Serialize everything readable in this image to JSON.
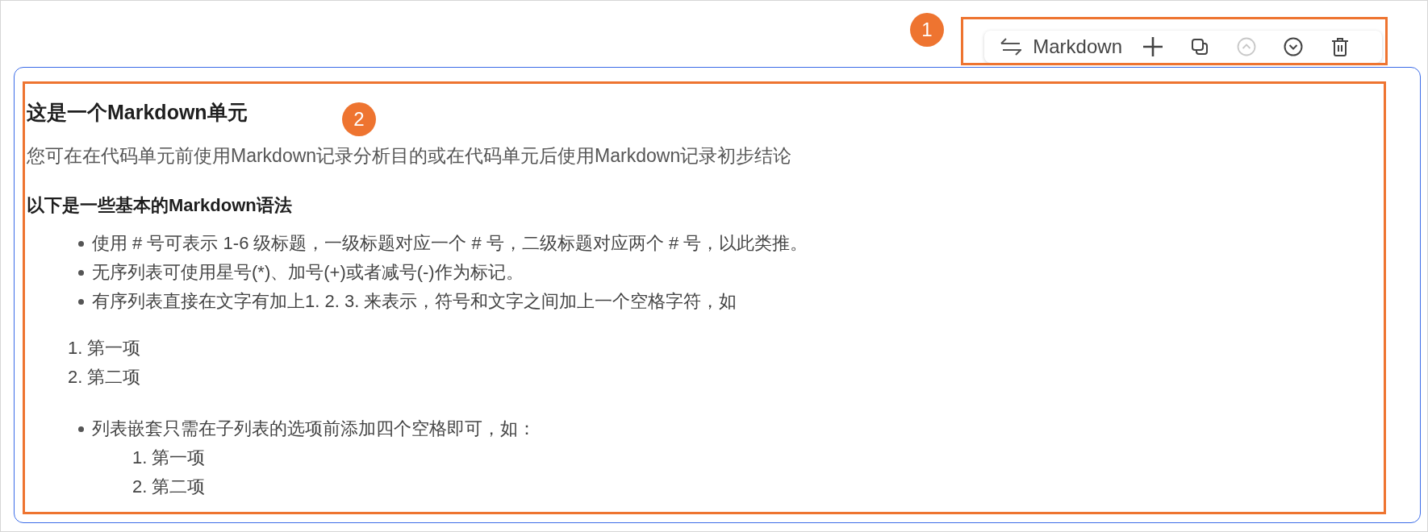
{
  "toolbar": {
    "cell_type": "Markdown",
    "buttons": [
      {
        "kind": "add",
        "disabled": false
      },
      {
        "kind": "copy",
        "disabled": false
      },
      {
        "kind": "move_up",
        "disabled": true
      },
      {
        "kind": "move_down",
        "disabled": false
      },
      {
        "kind": "delete",
        "disabled": false
      }
    ]
  },
  "annotations": [
    {
      "label": "1"
    },
    {
      "label": "2"
    }
  ],
  "cell": {
    "blocks": [
      {
        "kind": "heading",
        "text": "这是一个Markdown单元"
      },
      {
        "kind": "paragraph",
        "text": "您可在在代码单元前使用Markdown记录分析目的或在代码单元后使用Markdown记录初步结论"
      },
      {
        "kind": "subheading",
        "text": "以下是一些基本的Markdown语法"
      },
      {
        "kind": "bullets",
        "items": [
          {
            "text": "使用 # 号可表示 1-6 级标题，一级标题对应一个 # 号，二级标题对应两个 # 号，以此类推。"
          },
          {
            "text": "无序列表可使用星号(*)、加号(+)或者减号(-)作为标记。"
          },
          {
            "text": "有序列表直接在文字有加上1. 2. 3. 来表示，符号和文字之间加上一个空格字符，如"
          }
        ]
      },
      {
        "kind": "ordered",
        "items": [
          {
            "number": "1.",
            "text": "第一项"
          },
          {
            "number": "2.",
            "text": "第二项"
          }
        ]
      },
      {
        "kind": "bullets",
        "items": [
          {
            "text": "列表嵌套只需在子列表的选项前添加四个空格即可，如：",
            "children": [
              {
                "number": "1.",
                "text": "第一项"
              },
              {
                "number": "2.",
                "text": "第二项"
              }
            ]
          }
        ]
      }
    ]
  }
}
